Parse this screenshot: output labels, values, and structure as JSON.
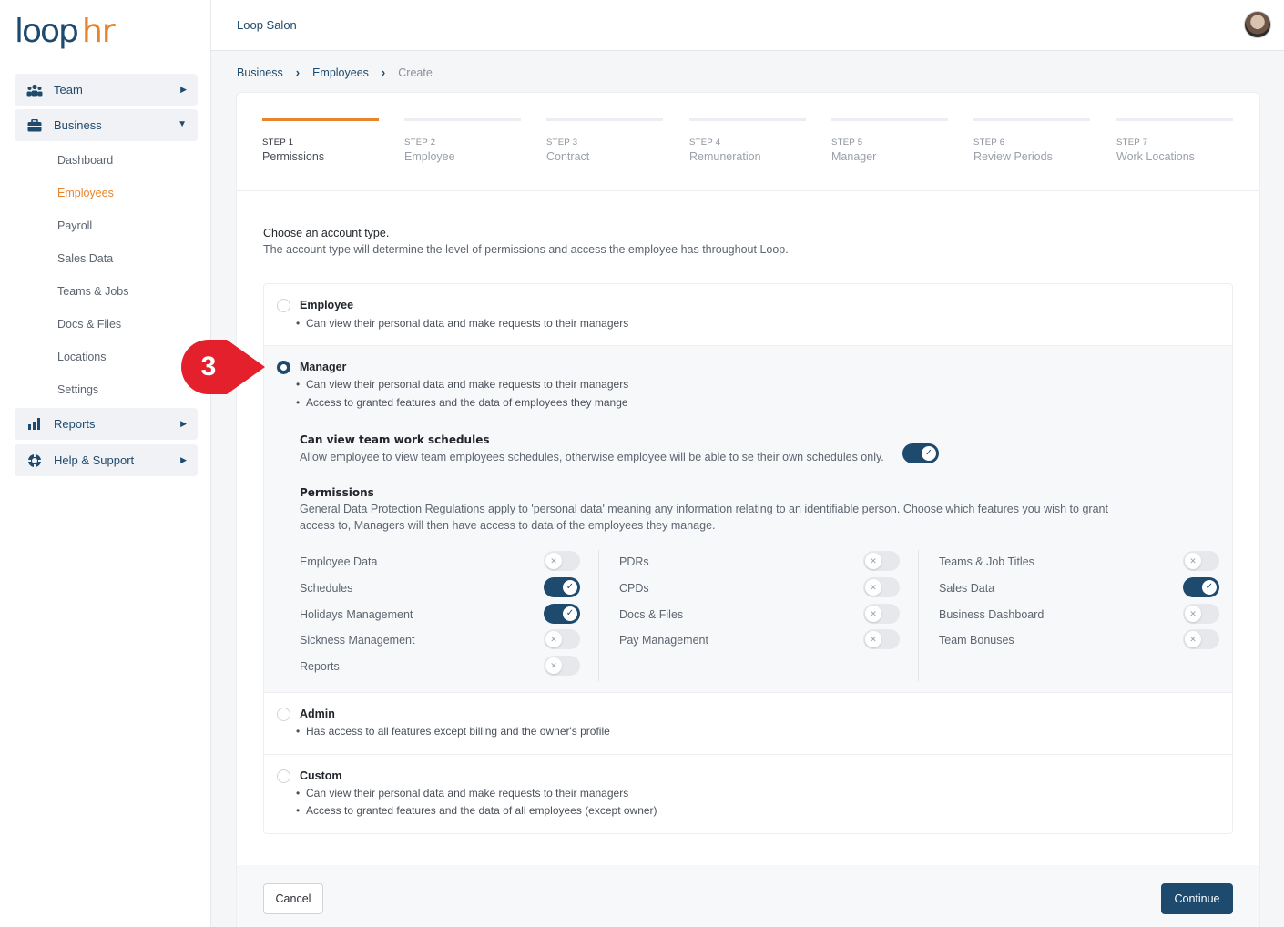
{
  "colors": {
    "accent": "#e8842c",
    "primary": "#1e4a6e",
    "annotation": "#e3202b"
  },
  "logo": {
    "text_loop": "loop",
    "text_hr": "hr"
  },
  "sidebar": {
    "groups": [
      {
        "label": "Team",
        "icon": "team-icon"
      },
      {
        "label": "Business",
        "icon": "briefcase-icon"
      },
      {
        "label": "Reports",
        "icon": "bar-chart-icon"
      },
      {
        "label": "Help & Support",
        "icon": "lifebuoy-icon"
      }
    ],
    "business_items": [
      "Dashboard",
      "Employees",
      "Payroll",
      "Sales Data",
      "Teams & Jobs",
      "Docs & Files",
      "Locations",
      "Settings"
    ],
    "active_item": "Employees"
  },
  "header": {
    "company": "Loop Salon"
  },
  "breadcrumb": {
    "items": [
      "Business",
      "Employees"
    ],
    "current": "Create"
  },
  "steps": [
    {
      "num": "STEP 1",
      "name": "Permissions"
    },
    {
      "num": "STEP 2",
      "name": "Employee"
    },
    {
      "num": "STEP 3",
      "name": "Contract"
    },
    {
      "num": "STEP 4",
      "name": "Remuneration"
    },
    {
      "num": "STEP 5",
      "name": "Manager"
    },
    {
      "num": "STEP 6",
      "name": "Review Periods"
    },
    {
      "num": "STEP 7",
      "name": "Work Locations"
    }
  ],
  "intro": {
    "title": "Choose an account type.",
    "subtitle": "The account type will determine the level of permissions and access the employee has throughout Loop."
  },
  "account_types": {
    "employee": {
      "title": "Employee",
      "bullets": [
        "Can view their personal data and make requests to their managers"
      ]
    },
    "manager": {
      "title": "Manager",
      "bullets": [
        "Can view their personal data and make requests to their managers",
        "Access to granted features and the data of employees they mange"
      ],
      "schedules_title": "Can view team work schedules",
      "schedules_desc": "Allow employee to view team employees schedules, otherwise employee will be able to se their own schedules only.",
      "schedules_enabled": true,
      "permissions_title": "Permissions",
      "permissions_desc": "General Data Protection Regulations apply to 'personal data' meaning any information relating to an identifiable person. Choose which features you wish to grant access to, Managers will then have access to data of the employees they manage."
    },
    "admin": {
      "title": "Admin",
      "bullets": [
        "Has access to all features except billing and the owner's profile"
      ]
    },
    "custom": {
      "title": "Custom",
      "bullets": [
        "Can view their personal data and make requests to their managers",
        "Access to granted features and the data of all employees (except owner)"
      ]
    },
    "selected": "Manager"
  },
  "permissions": {
    "col1": [
      {
        "label": "Employee Data",
        "on": false
      },
      {
        "label": "Schedules",
        "on": true
      },
      {
        "label": "Holidays Management",
        "on": true
      },
      {
        "label": "Sickness Management",
        "on": false
      },
      {
        "label": "Reports",
        "on": false
      }
    ],
    "col2": [
      {
        "label": "PDRs",
        "on": false
      },
      {
        "label": "CPDs",
        "on": false
      },
      {
        "label": "Docs & Files",
        "on": false
      },
      {
        "label": "Pay Management",
        "on": false
      }
    ],
    "col3": [
      {
        "label": "Teams & Job Titles",
        "on": false
      },
      {
        "label": "Sales Data",
        "on": true
      },
      {
        "label": "Business Dashboard",
        "on": false
      },
      {
        "label": "Team Bonuses",
        "on": false
      }
    ]
  },
  "footer": {
    "cancel": "Cancel",
    "continue": "Continue"
  },
  "annotation": {
    "number": "3"
  }
}
